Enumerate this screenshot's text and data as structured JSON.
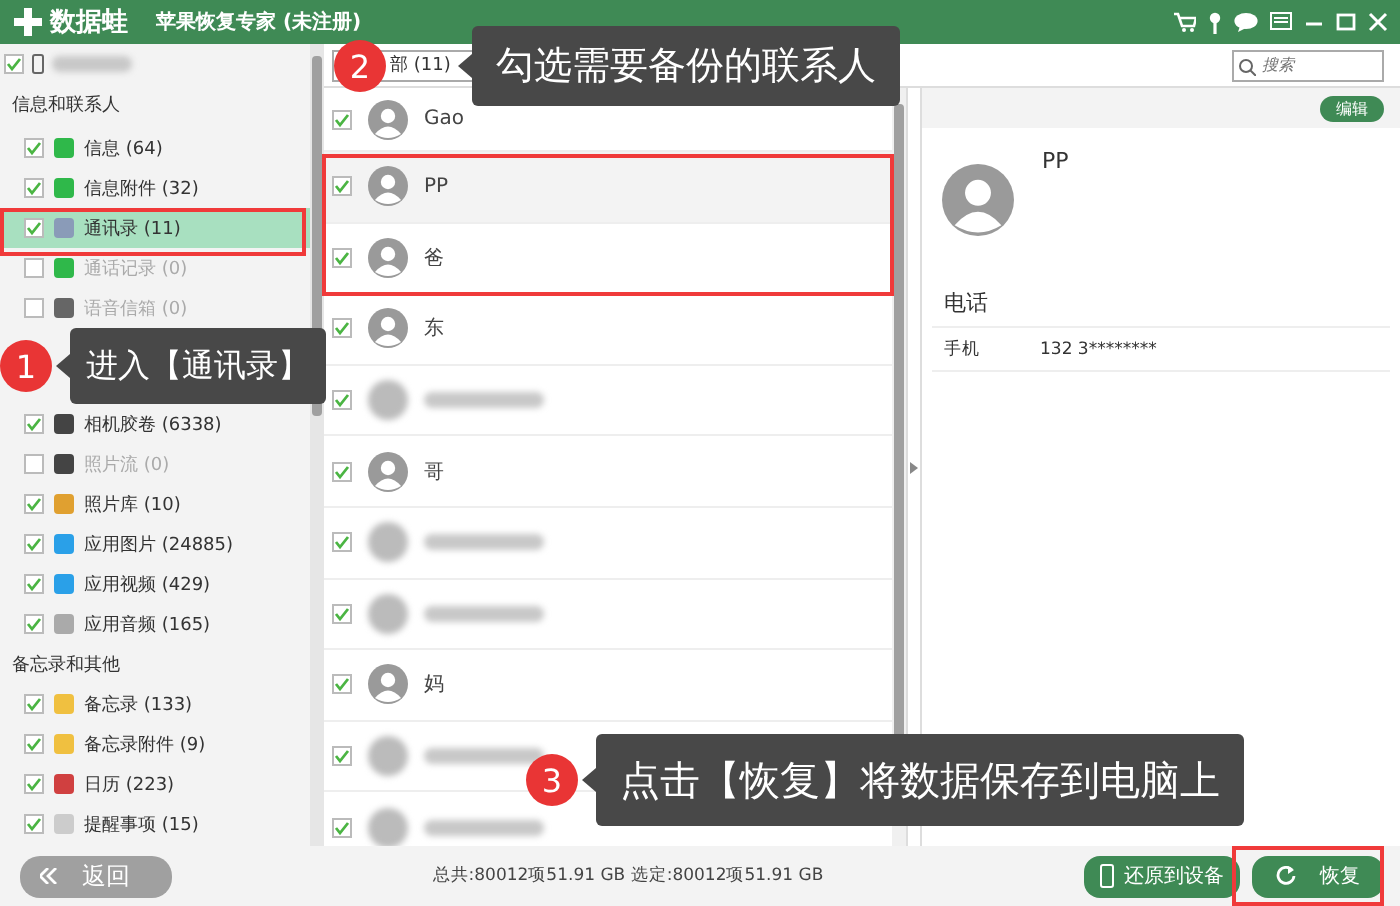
{
  "window": {
    "logo_text": "数据蛙",
    "title": "苹果恢复专家 (未注册)"
  },
  "sidebar": {
    "device": {
      "checked": true
    },
    "groups": [
      {
        "title": "信息和联系人",
        "items": [
          {
            "label": "信息 (64)",
            "checked": true,
            "selected": false,
            "disabled": false,
            "color": "#2fb84a"
          },
          {
            "label": "信息附件 (32)",
            "checked": true,
            "selected": false,
            "disabled": false,
            "color": "#2fb84a"
          },
          {
            "label": "通讯录 (11)",
            "checked": true,
            "selected": true,
            "disabled": false,
            "color": "#8a9bb8"
          },
          {
            "label": "通话记录 (0)",
            "checked": false,
            "selected": false,
            "disabled": true,
            "color": "#2fb84a"
          },
          {
            "label": "语音信箱 (0)",
            "checked": false,
            "selected": false,
            "disabled": true,
            "color": "#666666"
          },
          {
            "kind": "hidden"
          },
          {
            "label": "相机胶卷 (6338)",
            "checked": true,
            "selected": false,
            "disabled": false,
            "color": "#444444"
          },
          {
            "label": "照片流 (0)",
            "checked": false,
            "selected": false,
            "disabled": true,
            "color": "#444444"
          },
          {
            "label": "照片库 (10)",
            "checked": true,
            "selected": false,
            "disabled": false,
            "color": "#e0a030"
          },
          {
            "label": "应用图片 (24885)",
            "checked": true,
            "selected": false,
            "disabled": false,
            "color": "#2aa0e8"
          },
          {
            "label": "应用视频 (429)",
            "checked": true,
            "selected": false,
            "disabled": false,
            "color": "#2aa0e8"
          },
          {
            "label": "应用音频 (165)",
            "checked": true,
            "selected": false,
            "disabled": false,
            "color": "#aaaaaa"
          }
        ]
      },
      {
        "title": "备忘录和其他",
        "items": [
          {
            "label": "备忘录 (133)",
            "checked": true,
            "selected": false,
            "disabled": false,
            "color": "#f0c040"
          },
          {
            "label": "备忘录附件 (9)",
            "checked": true,
            "selected": false,
            "disabled": false,
            "color": "#f0c040"
          },
          {
            "label": "日历 (223)",
            "checked": true,
            "selected": false,
            "disabled": false,
            "color": "#d04040"
          },
          {
            "label": "提醒事项 (15)",
            "checked": true,
            "selected": false,
            "disabled": false,
            "color": "#cccccc"
          }
        ]
      }
    ]
  },
  "list": {
    "header": "部 (11)",
    "search": {
      "placeholder": "搜索"
    },
    "contacts": [
      {
        "name": "Gao",
        "checked": true,
        "selected": false,
        "blurred": false
      },
      {
        "name": "PP",
        "checked": true,
        "selected": true,
        "blurred": false
      },
      {
        "name": "爸",
        "checked": true,
        "selected": false,
        "blurred": false
      },
      {
        "name": "东",
        "checked": true,
        "selected": false,
        "blurred": false
      },
      {
        "checked": true,
        "selected": false,
        "blurred": true
      },
      {
        "name": "哥",
        "checked": true,
        "selected": false,
        "blurred": false
      },
      {
        "checked": true,
        "selected": false,
        "blurred": true
      },
      {
        "checked": true,
        "selected": false,
        "blurred": true
      },
      {
        "name": "妈",
        "checked": true,
        "selected": false,
        "blurred": false
      },
      {
        "checked": true,
        "selected": false,
        "blurred": true
      },
      {
        "checked": true,
        "selected": false,
        "blurred": true
      }
    ]
  },
  "detail": {
    "edit_button": "编辑",
    "name": "PP",
    "section": "电话",
    "fields": [
      {
        "label": "手机",
        "value": "132 3********"
      }
    ]
  },
  "footer": {
    "back_button": "返回",
    "status": "总共:80012项51.91 GB 选定:80012项51.91 GB",
    "restore_device_button": "还原到设备",
    "recover_button": "恢复"
  },
  "callouts": [
    {
      "number": "1",
      "text": "进入【通讯录】"
    },
    {
      "number": "2",
      "text": "勾选需要备份的联系人"
    },
    {
      "number": "3",
      "text": "点击【恢复】将数据保存到电脑上"
    }
  ]
}
